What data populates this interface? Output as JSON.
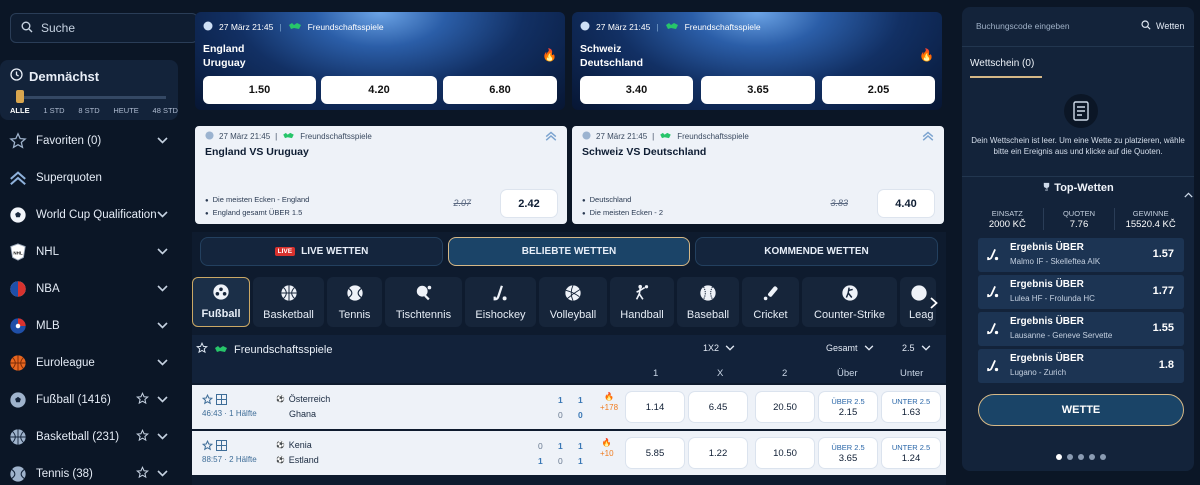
{
  "search": {
    "placeholder": "Suche"
  },
  "soon": {
    "title": "Demnächst",
    "ranges": [
      "ALLE",
      "1 STD",
      "8 STD",
      "HEUTE",
      "48 STD"
    ]
  },
  "sidebar": {
    "items": [
      {
        "label": "Favoriten (0)",
        "icon": "star-icon",
        "chevron": true,
        "star": false
      },
      {
        "label": "Superquoten",
        "icon": "double-chevron-up-icon",
        "chevron": false,
        "star": false
      },
      {
        "label": "World Cup Qualification",
        "icon": "soccer-ball-icon",
        "chevron": true,
        "star": false
      },
      {
        "label": "NHL",
        "icon": "nhl-logo-icon",
        "chevron": true,
        "star": false
      },
      {
        "label": "NBA",
        "icon": "nba-logo-icon",
        "chevron": true,
        "star": false
      },
      {
        "label": "MLB",
        "icon": "mlb-logo-icon",
        "chevron": true,
        "star": false
      },
      {
        "label": "Euroleague",
        "icon": "basketball-icon",
        "chevron": true,
        "star": false
      },
      {
        "label": "Fußball (1416)",
        "icon": "soccer-ball-icon",
        "chevron": true,
        "star": true
      },
      {
        "label": "Basketball (231)",
        "icon": "basketball-icon",
        "chevron": true,
        "star": true
      },
      {
        "label": "Tennis (38)",
        "icon": "tennis-ball-icon",
        "chevron": true,
        "star": true
      }
    ]
  },
  "banners": [
    {
      "date": "27 März 21:45",
      "league": "Freundschaftsspiele",
      "home": "England",
      "away": "Uruguay",
      "odds": [
        "1.50",
        "4.20",
        "6.80"
      ]
    },
    {
      "date": "27 März 21:45",
      "league": "Freundschaftsspiele",
      "home": "Schweiz",
      "away": "Deutschland",
      "odds": [
        "3.40",
        "3.65",
        "2.05"
      ]
    }
  ],
  "boost_cards": [
    {
      "date": "27 März 21:45",
      "league": "Freundschaftsspiele",
      "title": "England VS Uruguay",
      "legs": [
        "Die meisten Ecken - England",
        "England gesamt ÜBER 1.5"
      ],
      "old_odd": "2.07",
      "new_odd": "2.42"
    },
    {
      "date": "27 März 21:45",
      "league": "Freundschaftsspiele",
      "title": "Schweiz VS Deutschland",
      "legs": [
        "Deutschland",
        "Die meisten Ecken - 2"
      ],
      "old_odd": "3.83",
      "new_odd": "4.40"
    }
  ],
  "tabs": {
    "live": "LIVE WETTEN",
    "live_badge": "LIVE",
    "popular": "BELIEBTE WETTEN",
    "upcoming": "KOMMENDE WETTEN"
  },
  "sports": [
    {
      "label": "Fußball",
      "icon": "soccer-ball-icon"
    },
    {
      "label": "Basketball",
      "icon": "basketball-icon"
    },
    {
      "label": "Tennis",
      "icon": "tennis-ball-icon"
    },
    {
      "label": "Tischtennis",
      "icon": "table-tennis-icon"
    },
    {
      "label": "Eishockey",
      "icon": "hockey-stick-icon"
    },
    {
      "label": "Volleyball",
      "icon": "volleyball-icon"
    },
    {
      "label": "Handball",
      "icon": "handball-player-icon"
    },
    {
      "label": "Baseball",
      "icon": "baseball-icon"
    },
    {
      "label": "Cricket",
      "icon": "cricket-bat-icon"
    },
    {
      "label": "Counter-Strike",
      "icon": "counter-strike-icon"
    },
    {
      "label": "Leag",
      "icon": "league-icon"
    }
  ],
  "league": {
    "name": "Freundschaftsspiele",
    "market1": "1X2",
    "market2": "Gesamt",
    "line": "2.5"
  },
  "columns": {
    "c1": "1",
    "cx": "X",
    "c2": "2",
    "over": "Über",
    "under": "Unter"
  },
  "matches": [
    {
      "time": "46:43",
      "period": "1 Hälfte",
      "home": "Österreich",
      "away": "Ghana",
      "h1": "1",
      "h2": "1",
      "a1": "0",
      "a2": "0",
      "heat": "+178",
      "o1": "1.14",
      "ox": "6.45",
      "o2": "20.50",
      "over_label": "ÜBER 2.5",
      "over": "2.15",
      "under_label": "UNTER 2.5",
      "under": "1.63"
    },
    {
      "time": "88:57",
      "period": "2 Hälfte",
      "home": "Kenia",
      "away": "Estland",
      "h0": "0",
      "h1": "1",
      "h2": "1",
      "a0": "1",
      "a1": "0",
      "a2": "1",
      "heat": "+10",
      "o1": "5.85",
      "ox": "1.22",
      "o2": "10.50",
      "over_label": "ÜBER 2.5",
      "over": "3.65",
      "under_label": "UNTER 2.5",
      "under": "1.24"
    }
  ],
  "betslip": {
    "code_placeholder": "Buchungscode eingeben",
    "code_button": "Wetten",
    "tab": "Wettschein (0)",
    "empty_text": "Dein Wettschein ist leer. Um eine Wette zu platzieren, wähle bitte ein Ereignis aus und klicke auf die Quoten."
  },
  "top_wetten": {
    "title": "Top-Wetten",
    "stake_label": "EINSATZ",
    "stake": "2000 KČ",
    "odds_label": "QUOTEN",
    "odds": "7.76",
    "win_label": "GEWINNE",
    "win": "15520.4 KČ",
    "items": [
      {
        "market": "Ergebnis ÜBER",
        "match": "Malmo IF - Skelleftea AIK",
        "odd": "1.57"
      },
      {
        "market": "Ergebnis ÜBER",
        "match": "Lulea HF - Frolunda HC",
        "odd": "1.77"
      },
      {
        "market": "Ergebnis ÜBER",
        "match": "Lausanne - Geneve Servette",
        "odd": "1.55"
      },
      {
        "market": "Ergebnis ÜBER",
        "match": "Lugano - Zurich",
        "odd": "1.8"
      }
    ],
    "button": "WETTE"
  },
  "colors": {
    "accent_gold": "#d5b887",
    "live_red": "#d8322e",
    "link_blue": "#2966a8"
  }
}
